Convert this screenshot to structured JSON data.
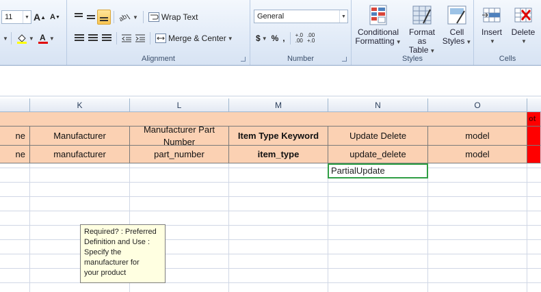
{
  "ribbon": {
    "font": {
      "size": "11",
      "grow_label": "A",
      "shrink_label": "A"
    },
    "alignment": {
      "wrap_text": "Wrap Text",
      "merge_center": "Merge & Center",
      "label": "Alignment"
    },
    "number": {
      "format": "General",
      "currency": "$",
      "percent": "%",
      "comma": ",",
      "inc_decimal": "+.0",
      "inc_decimal_2": ".00",
      "dec_decimal": ".00",
      "dec_decimal_2": "+.0",
      "label": "Number"
    },
    "styles": {
      "conditional_1": "Conditional",
      "conditional_2": "Formatting",
      "table_1": "Format",
      "table_2": "as Table",
      "cell_1": "Cell",
      "cell_2": "Styles",
      "label": "Styles"
    },
    "cells": {
      "insert": "Insert",
      "delete": "Delete",
      "label": "Cells"
    }
  },
  "grid": {
    "columns": [
      "",
      "K",
      "L",
      "M",
      "N",
      "O"
    ],
    "rows": [
      {
        "j": "ne",
        "k": "Manufacturer",
        "l_1": "Manufacturer Part",
        "l_2": "Number",
        "m": "Item Type Keyword",
        "n": "Update Delete",
        "o": "model",
        "p": "ot"
      },
      {
        "j": "ne",
        "k": "manufacturer",
        "l": "part_number",
        "m": "item_type",
        "n": "update_delete",
        "o": "model"
      }
    ],
    "active_cell_value": "PartialUpdate"
  },
  "comment": {
    "text": "Required? : Preferred\nDefinition and Use :\nSpecify the\nmanufacturer for\nyour product"
  },
  "colors": {
    "header_fill": "#fbd1b3",
    "required_fill": "#ff0000",
    "active_border": "#2f9e44",
    "comment_fill": "#ffffe1"
  }
}
